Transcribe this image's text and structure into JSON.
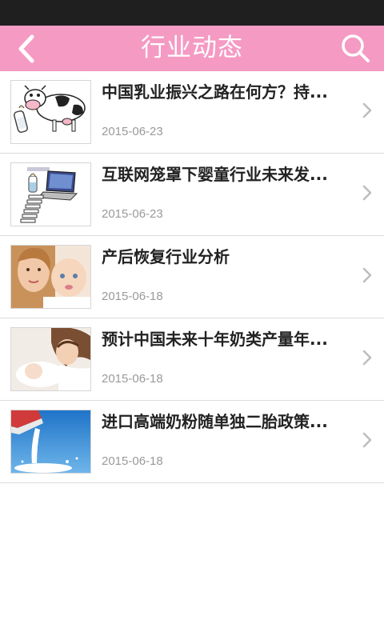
{
  "header": {
    "title": "行业动态",
    "back_icon": "chevron-left-icon",
    "search_icon": "search-icon",
    "background_color": "#f59ac3"
  },
  "news": [
    {
      "title": "中国乳业振兴之路在何方？持...",
      "date": "2015-06-23",
      "thumb": "cow-bottle"
    },
    {
      "title": "互联网笼罩下婴童行业未来发...",
      "date": "2015-06-23",
      "thumb": "laptop-bottle"
    },
    {
      "title": "产后恢复行业分析",
      "date": "2015-06-18",
      "thumb": "mother-baby"
    },
    {
      "title": "预计中国未来十年奶类产量年...",
      "date": "2015-06-18",
      "thumb": "mother-sleeping-baby"
    },
    {
      "title": "进口高端奶粉随单独二胎政策...",
      "date": "2015-06-18",
      "thumb": "milk-splash"
    }
  ]
}
